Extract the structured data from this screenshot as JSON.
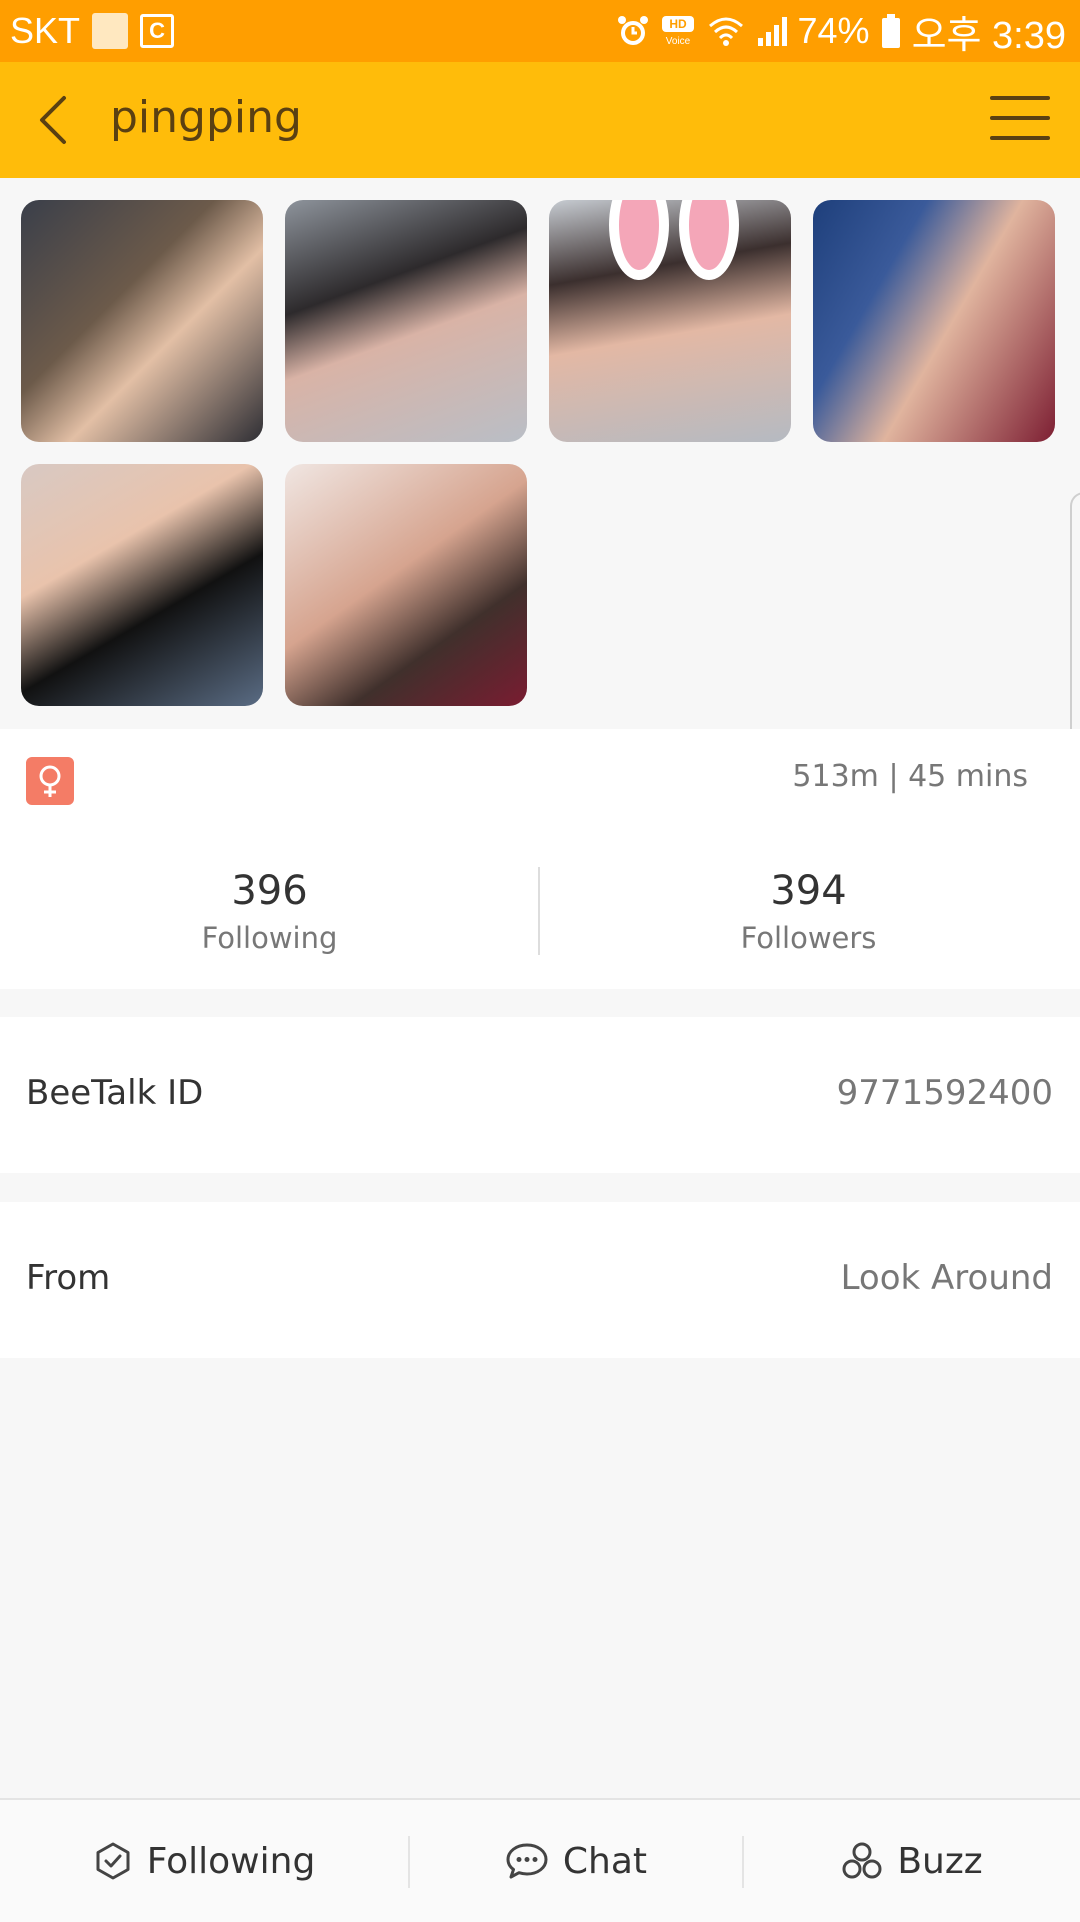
{
  "status_bar": {
    "carrier": "SKT",
    "c_badge": "C",
    "battery": "74%",
    "time": "오후 3:39",
    "hd_voice": "HD Voice"
  },
  "header": {
    "title": "pingping"
  },
  "photos": [
    {
      "name": "photo-1"
    },
    {
      "name": "photo-2"
    },
    {
      "name": "photo-3"
    },
    {
      "name": "photo-4"
    },
    {
      "name": "photo-5"
    },
    {
      "name": "photo-6"
    }
  ],
  "profile": {
    "gender_icon": "female-icon",
    "distance_time": "513m | 45 mins",
    "following_count": "396",
    "following_label": "Following",
    "followers_count": "394",
    "followers_label": "Followers"
  },
  "details": {
    "id_label": "BeeTalk ID",
    "id_value": "9771592400",
    "from_label": "From",
    "from_value": "Look Around"
  },
  "bottom_bar": {
    "following_label": "Following",
    "chat_label": "Chat",
    "buzz_label": "Buzz"
  },
  "colors": {
    "status_bar": "#ff9e00",
    "app_bar": "#ffbc0a",
    "gender_badge": "#f47c66"
  }
}
